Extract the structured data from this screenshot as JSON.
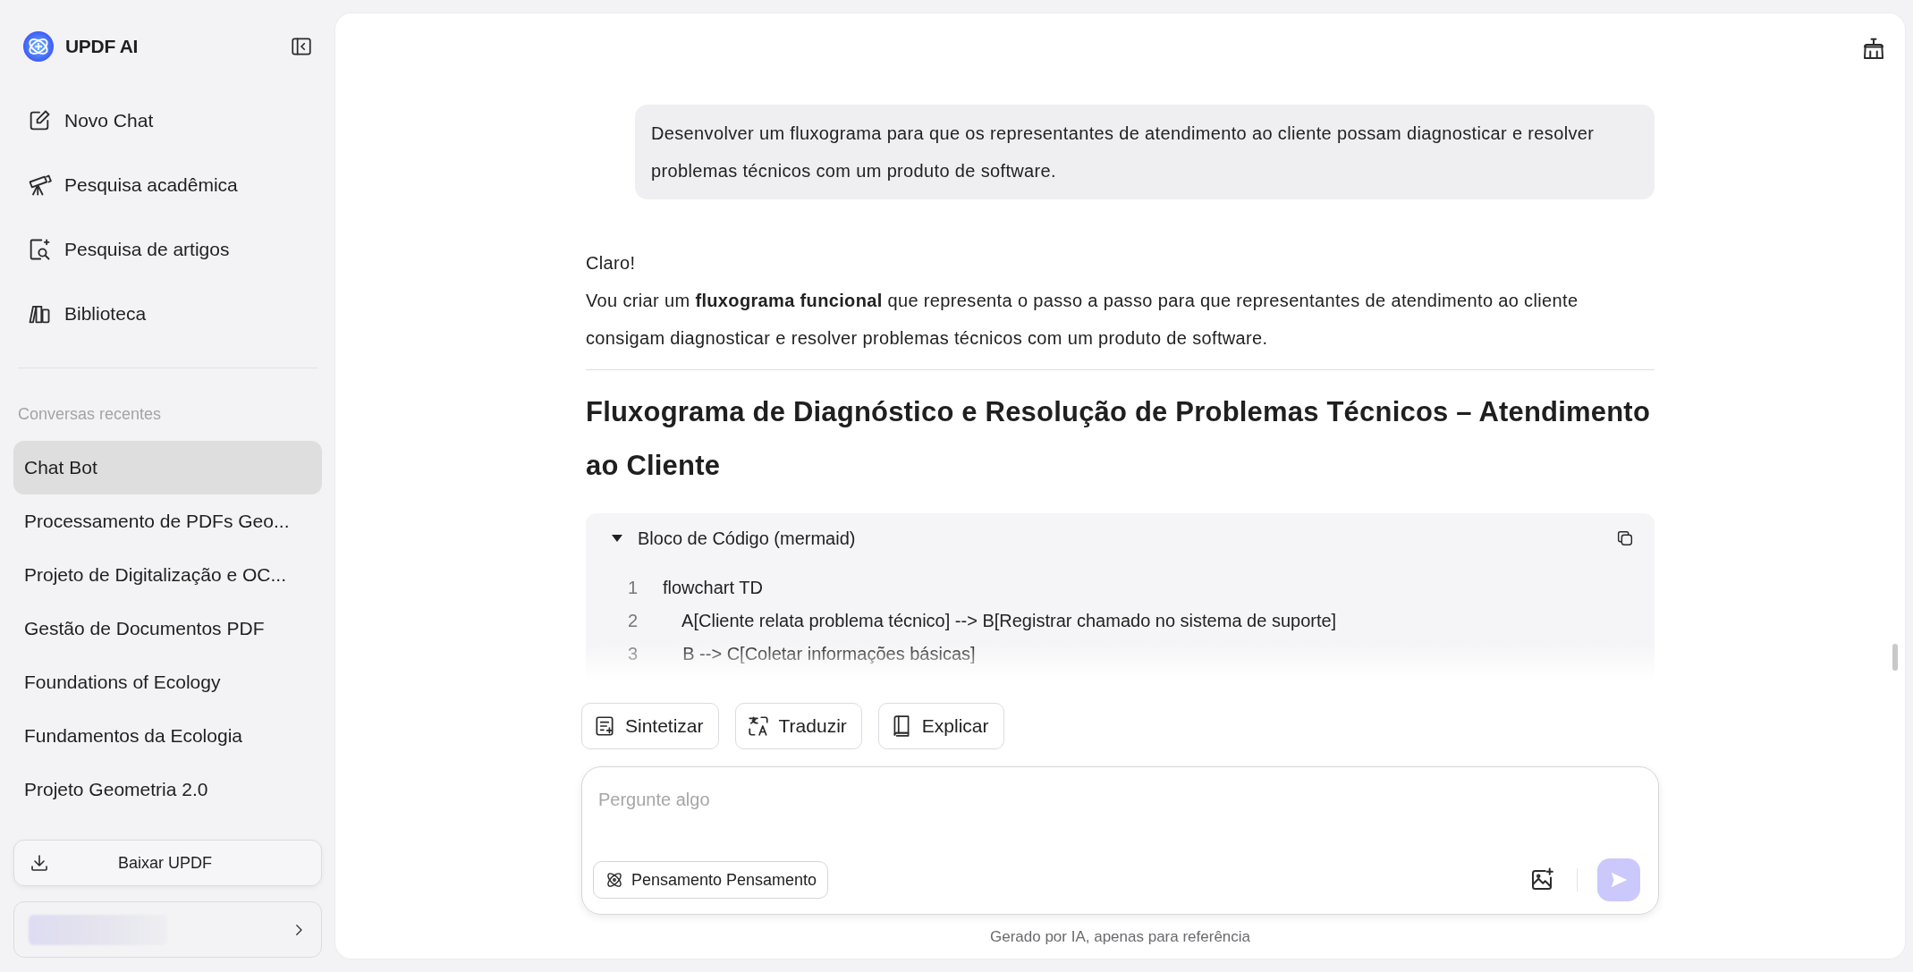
{
  "app": {
    "name": "UPDF AI"
  },
  "nav": [
    {
      "label": "Novo Chat",
      "kind": "new-chat"
    },
    {
      "label": "Pesquisa acadêmica",
      "kind": "academic"
    },
    {
      "label": "Pesquisa de artigos",
      "kind": "articles"
    },
    {
      "label": "Biblioteca",
      "kind": "library"
    }
  ],
  "recent": {
    "title": "Conversas recentes",
    "items": [
      {
        "label": "Chat Bot",
        "selected": true
      },
      {
        "label": "Processamento de PDFs Geo...",
        "selected": false
      },
      {
        "label": "Projeto de Digitalização e OC...",
        "selected": false
      },
      {
        "label": "Gestão de Documentos PDF",
        "selected": false
      },
      {
        "label": "Foundations of Ecology",
        "selected": false
      },
      {
        "label": "Fundamentos da Ecologia",
        "selected": false
      },
      {
        "label": "Projeto Geometria 2.0",
        "selected": false
      }
    ]
  },
  "download_button": "Baixar UPDF",
  "conversation": {
    "user_message": "Desenvolver um fluxograma para que os representantes de atendimento ao cliente possam diagnosticar e resolver problemas técnicos com um produto de software.",
    "reply": {
      "greeting": "Claro!",
      "intro": "Vou criar um **fluxograma funcional** que representa o passo a passo para que representantes de atendimento ao cliente consigam diagnosticar e resolver problemas técnicos com um produto de software.",
      "heading": "Fluxograma de Diagnóstico e Resolução de Problemas Técnicos – Atendimento ao Cliente",
      "code_block": {
        "title": "Bloco de Código (mermaid)",
        "expanded": true,
        "lines": [
          {
            "number": "1",
            "code": "flowchart TD"
          },
          {
            "number": "2",
            "code": "    A[Cliente relata problema técnico] --> B[Registrar chamado no sistema de suporte]"
          },
          {
            "number": "3",
            "code": "    B --> C[Coletar informações básicas]"
          }
        ]
      }
    }
  },
  "actions": [
    {
      "label": "Sintetizar",
      "kind": "summarize"
    },
    {
      "label": "Traduzir",
      "kind": "translate"
    },
    {
      "label": "Explicar",
      "kind": "explain"
    }
  ],
  "composer": {
    "placeholder": "Pergunte algo",
    "mode_button": "Pensamento Pensamento",
    "send_disabled": true
  },
  "disclaimer": "Gerado por IA, apenas para referência"
}
